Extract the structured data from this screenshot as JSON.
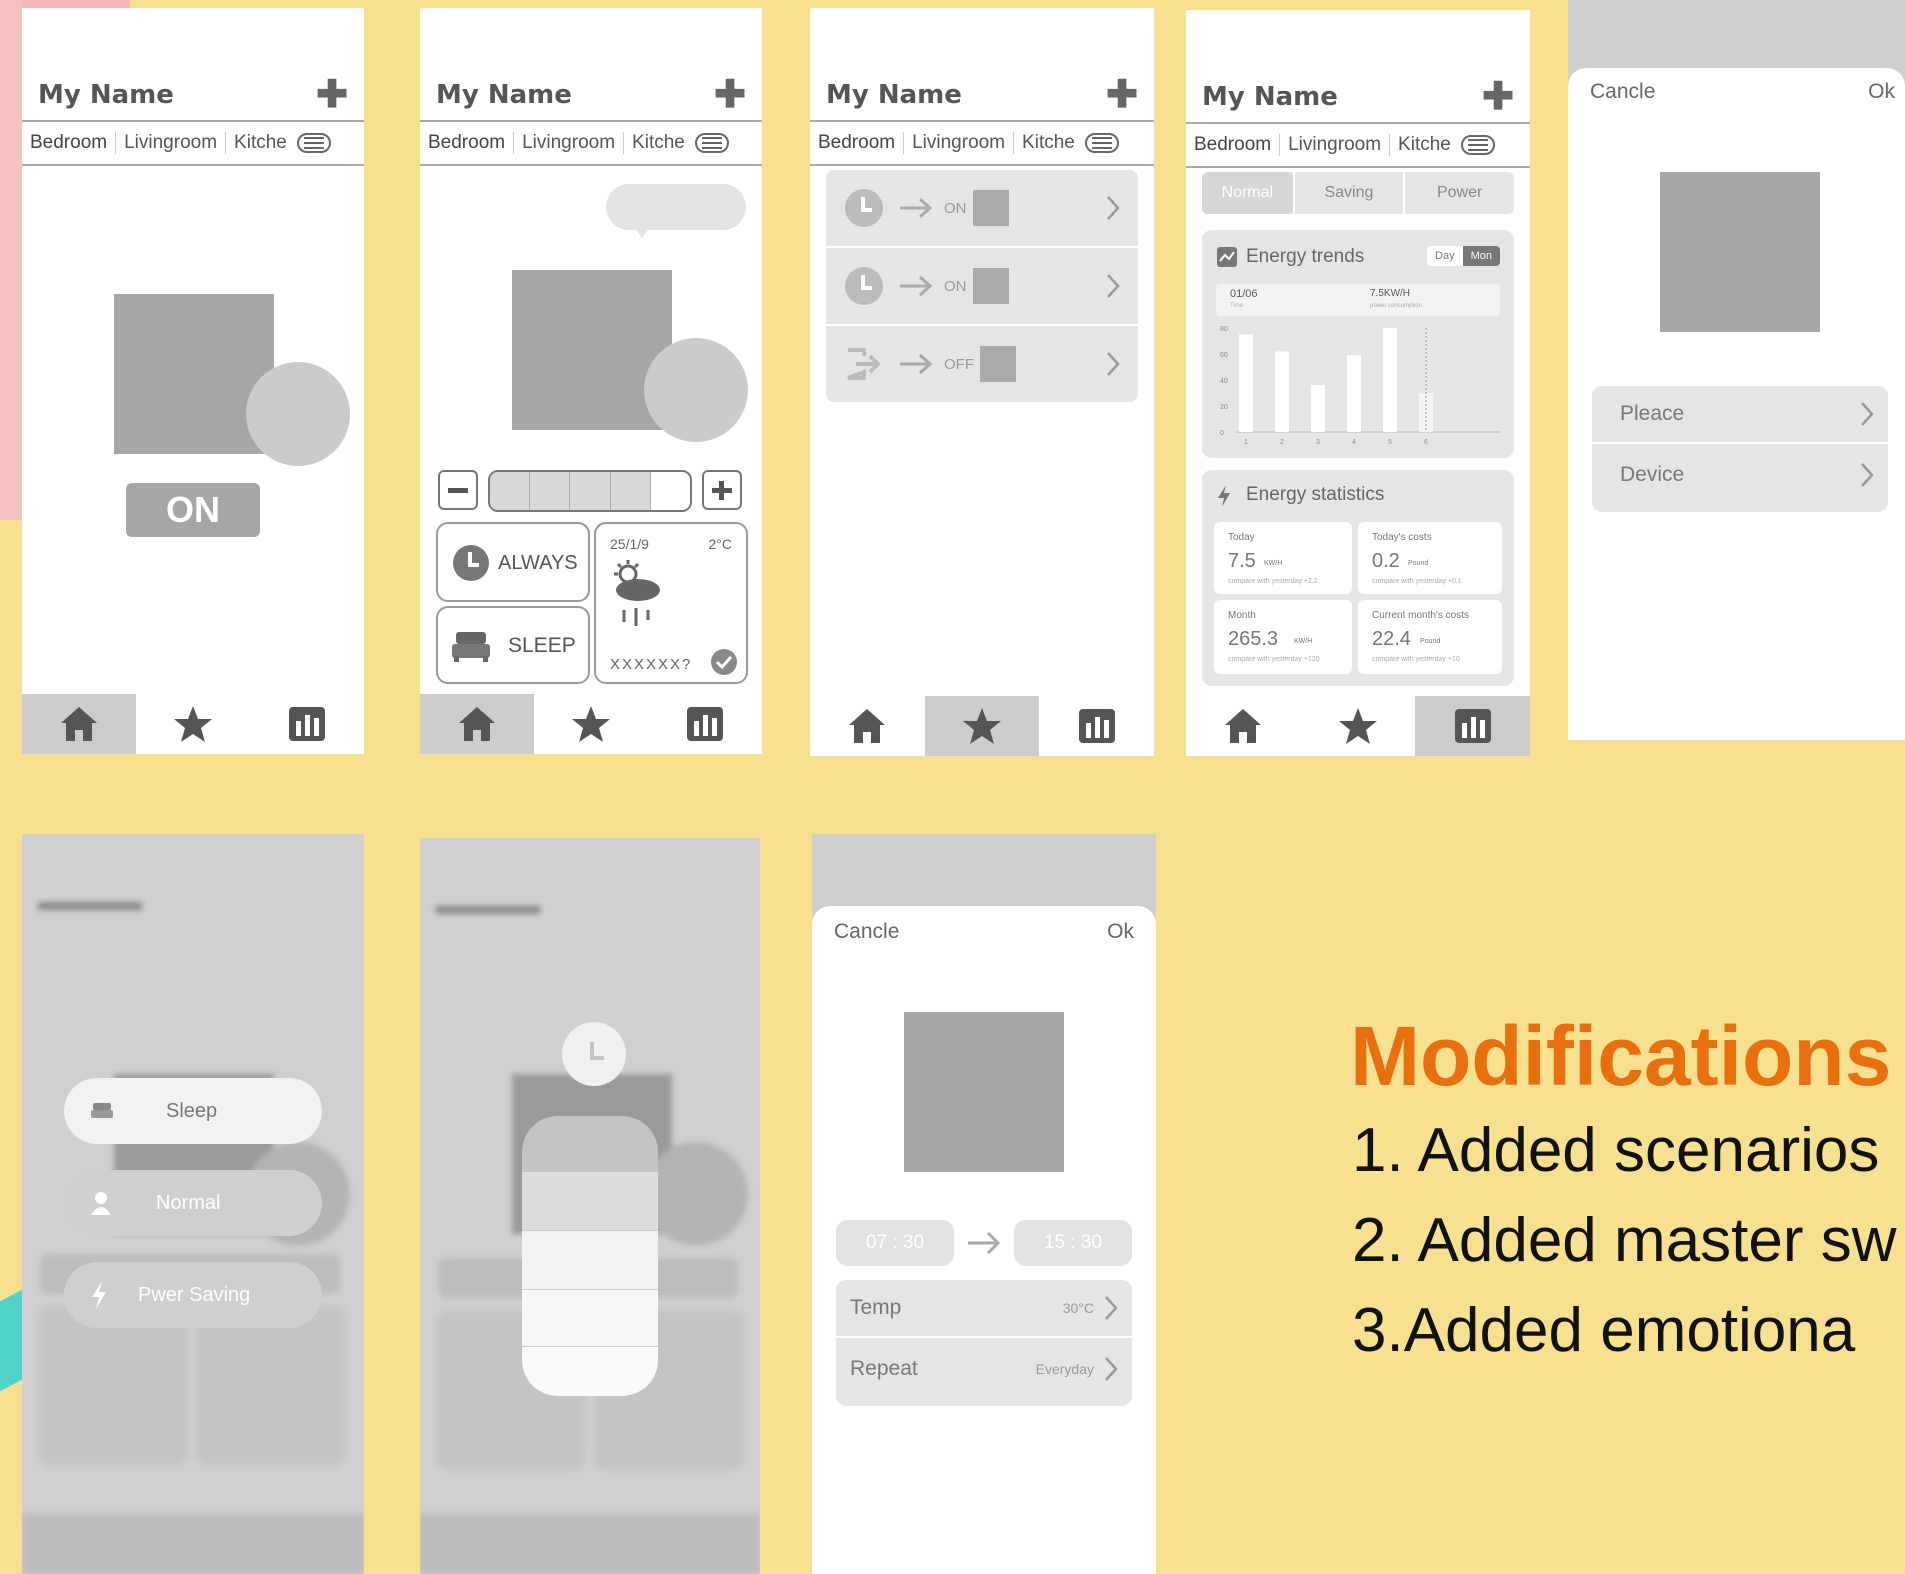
{
  "header": {
    "name": "My Name",
    "add_symbol": "✚"
  },
  "tabs": [
    "Bedroom",
    "Livingroom",
    "Kitche"
  ],
  "nav": [
    "home-icon",
    "star-icon",
    "chart-icon"
  ],
  "screen1": {
    "power_button": "ON"
  },
  "screen2": {
    "mode_always": "ALWAYS",
    "mode_sleep": "SLEEP",
    "weather_date": "25/1/9",
    "weather_temp": "2°C",
    "weather_text": "XXXXXX?"
  },
  "screen3": {
    "rows": [
      {
        "trigger": "clock-icon",
        "action": "ON"
      },
      {
        "trigger": "clock-icon",
        "action": "ON"
      },
      {
        "trigger": "exit-icon",
        "action": "OFF"
      }
    ]
  },
  "screen4": {
    "modes": [
      "Normal",
      "Saving",
      "Power"
    ],
    "trends_title": "Energy trends",
    "toggle": [
      "Day",
      "Mon"
    ],
    "trend_info": {
      "date": "01/06",
      "date_sub": "Time",
      "value": "7.5KW/H",
      "value_sub": "power consumption"
    },
    "stats_title": "Energy statistics",
    "stats": [
      {
        "label": "Today",
        "value": "7.5",
        "unit": "KW/H",
        "note": "compare with yesterday +2.2"
      },
      {
        "label": "Today's costs",
        "value": "0.2",
        "unit": "Pound",
        "note": "compare with yesterday +0.1"
      },
      {
        "label": "Month",
        "value": "265.3",
        "unit": "KW/H",
        "note": "compare with yesterday +120"
      },
      {
        "label": "Current month's costs",
        "value": "22.4",
        "unit": "Pound",
        "note": "compare with yesterday +10"
      }
    ]
  },
  "chart_data": {
    "type": "bar",
    "categories": [
      "1",
      "2",
      "3",
      "4",
      "5",
      "6"
    ],
    "values": [
      75,
      62,
      36,
      59,
      80,
      30
    ],
    "yticks": [
      "0",
      "20",
      "40",
      "60",
      "80"
    ],
    "ylim": [
      0,
      80
    ]
  },
  "screen5": {
    "cancel": "Cancle",
    "ok": "Ok",
    "rows": [
      "Pleace",
      "Device"
    ]
  },
  "screen6": {
    "scenes": [
      {
        "icon": "bed-icon",
        "label": "Sleep"
      },
      {
        "icon": "person-icon",
        "label": "Normal"
      },
      {
        "icon": "lightning-icon",
        "label": "Pwer Saving"
      }
    ]
  },
  "screen8": {
    "cancel": "Cancle",
    "ok": "Ok",
    "start_time": "07 : 30",
    "end_time": "15 : 30",
    "temp_label": "Temp",
    "temp_value": "30°C",
    "repeat_label": "Repeat",
    "repeat_value": "Everyday"
  },
  "modifications": {
    "title": "Modifications",
    "lines": [
      "1. Added scenarios",
      "2. Added master sw",
      "3.Added emotiona"
    ]
  }
}
